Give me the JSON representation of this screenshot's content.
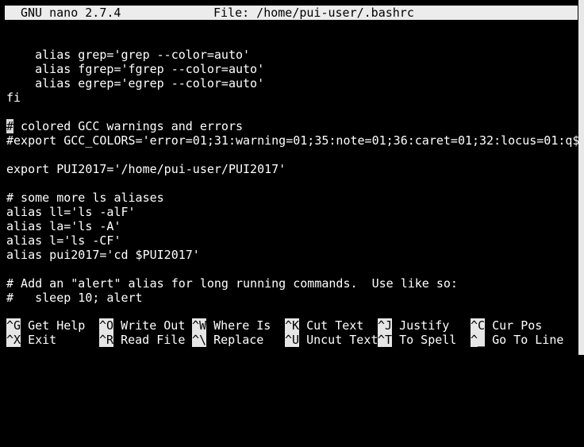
{
  "window": {
    "app_title": "GNU nano 2.7.4",
    "file_title": "File: /home/pui-user/.bashrc"
  },
  "editor": {
    "lines": [
      "",
      "    alias grep='grep --color=auto'",
      "    alias fgrep='fgrep --color=auto'",
      "    alias egrep='egrep --color=auto'",
      "fi",
      "",
      " colored GCC warnings and errors",
      "#export GCC_COLORS='error=01;31:warning=01;35:note=01;36:caret=01;32:locus=01:q$",
      "",
      "export PUI2017='/home/pui-user/PUI2017'",
      "",
      "# some more ls aliases",
      "alias ll='ls -alF'",
      "alias la='ls -A'",
      "alias l='ls -CF'",
      "alias pui2017='cd $PUI2017'",
      "",
      "# Add an \"alert\" alias for long running commands.  Use like so:",
      "#   sleep 10; alert"
    ],
    "cursor_char": "#"
  },
  "shortcuts": {
    "row1": [
      {
        "key": "^G",
        "label": "Get Help"
      },
      {
        "key": "^O",
        "label": "Write Out"
      },
      {
        "key": "^W",
        "label": "Where Is"
      },
      {
        "key": "^K",
        "label": "Cut Text"
      },
      {
        "key": "^J",
        "label": "Justify"
      },
      {
        "key": "^C",
        "label": "Cur Pos"
      }
    ],
    "row2": [
      {
        "key": "^X",
        "label": "Exit"
      },
      {
        "key": "^R",
        "label": "Read File"
      },
      {
        "key": "^\\",
        "label": "Replace"
      },
      {
        "key": "^U",
        "label": "Uncut Text"
      },
      {
        "key": "^T",
        "label": "To Spell"
      },
      {
        "key": "^_",
        "label": "Go To Line"
      }
    ]
  },
  "colors": {
    "background": "#000000",
    "foreground": "#ffffff",
    "bar": "#ececec"
  }
}
